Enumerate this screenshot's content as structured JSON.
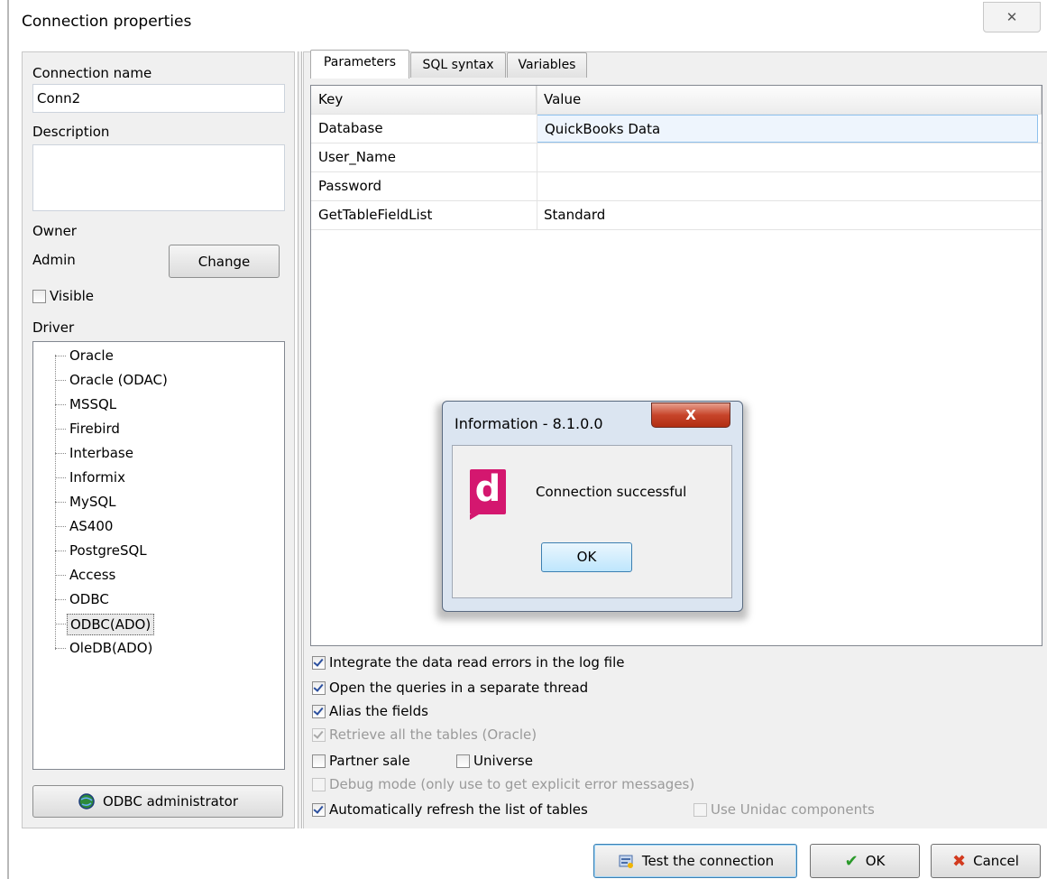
{
  "window": {
    "title": "Connection properties",
    "close_glyph": "✕"
  },
  "left": {
    "connection_name_label": "Connection name",
    "connection_name_value": "Conn2",
    "description_label": "Description",
    "description_value": "",
    "owner_label": "Owner",
    "owner_value": "Admin",
    "change_label": "Change",
    "visible_label": "Visible",
    "visible_checked": false,
    "driver_label": "Driver",
    "drivers": [
      "Oracle",
      "Oracle (ODAC)",
      "MSSQL",
      "Firebird",
      "Interbase",
      "Informix",
      "MySQL",
      "AS400",
      "PostgreSQL",
      "Access",
      "ODBC",
      "ODBC(ADO)",
      "OleDB(ADO)"
    ],
    "selected_driver": "ODBC(ADO)",
    "odbc_admin_label": "ODBC administrator"
  },
  "tabs": [
    {
      "label": "Parameters",
      "active": true
    },
    {
      "label": "SQL syntax",
      "active": false
    },
    {
      "label": "Variables",
      "active": false
    }
  ],
  "grid": {
    "headers": [
      "Key",
      "Value"
    ],
    "rows": [
      {
        "key": "Database",
        "value": "QuickBooks Data"
      },
      {
        "key": "User_Name",
        "value": ""
      },
      {
        "key": "Password",
        "value": ""
      },
      {
        "key": "GetTableFieldList",
        "value": "Standard"
      }
    ]
  },
  "options": {
    "integrate_errors": "Integrate the data read errors in the log file",
    "separate_thread": "Open the queries in a separate thread",
    "alias_fields": "Alias the fields",
    "retrieve_tables": "Retrieve all the tables (Oracle)",
    "partner_sale": "Partner sale",
    "universe": "Universe",
    "debug_mode": "Debug mode (only use to get explicit error messages)",
    "auto_refresh": "Automatically refresh the list of tables",
    "use_unidac": "Use Unidac components"
  },
  "dialog": {
    "title": "Information - 8.1.0.0",
    "close_glyph": "X",
    "icon_letter": "d",
    "message": "Connection successful",
    "ok_label": "OK"
  },
  "buttons": {
    "test": "Test the connection",
    "ok": "OK",
    "cancel": "Cancel"
  },
  "colors": {
    "accent": "#3c7fb1",
    "brand_icon": "#d4176f",
    "dialog_close": "#c7442a"
  }
}
